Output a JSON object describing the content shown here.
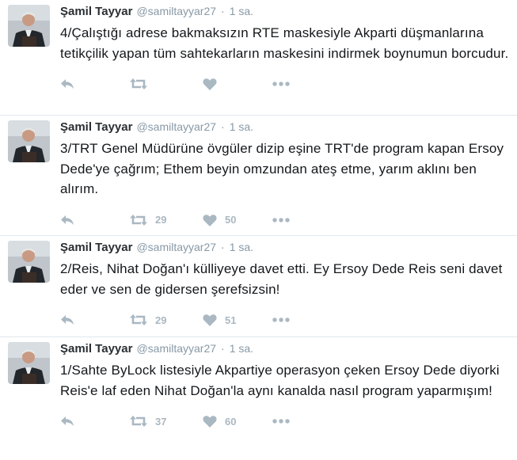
{
  "tweets": [
    {
      "fullname": "Şamil Tayyar",
      "username": "@samiltayyar27",
      "separator": "·",
      "time": "1 sa.",
      "text": "4/Çalıştığı adrese bakmaksızın RTE maskesiyle Akparti düşmanlarına tetikçilik yapan tüm sahtekarların maskesini indirmek boynumun borcudur.",
      "retweets": "",
      "likes": ""
    },
    {
      "fullname": "Şamil Tayyar",
      "username": "@samiltayyar27",
      "separator": "·",
      "time": "1 sa.",
      "text": "3/TRT Genel Müdürüne övgüler dizip eşine TRT'de program kapan Ersoy Dede'ye çağrım; Ethem beyin omzundan ateş etme, yarım aklını ben alırım.",
      "retweets": "29",
      "likes": "50"
    },
    {
      "fullname": "Şamil Tayyar",
      "username": "@samiltayyar27",
      "separator": "·",
      "time": "1 sa.",
      "text": "2/Reis, Nihat Doğan'ı külliyeye davet etti. Ey Ersoy Dede Reis seni davet eder ve sen de gidersen şerefsizsin!",
      "retweets": "29",
      "likes": "51"
    },
    {
      "fullname": "Şamil Tayyar",
      "username": "@samiltayyar27",
      "separator": "·",
      "time": "1 sa.",
      "text": "1/Sahte ByLock listesiyle Akpartiye operasyon çeken Ersoy Dede diyorki Reis'e laf eden Nihat Doğan'la aynı kanalda nasıl program yaparmışım!",
      "retweets": "37",
      "likes": "60"
    }
  ],
  "icons": {
    "reply": "reply-icon",
    "retweet": "retweet-icon",
    "like": "heart-icon",
    "more": "more-dots-icon"
  },
  "colors": {
    "name": "#292f33",
    "muted": "#8899a6",
    "action": "#aab8c2",
    "text": "#14171a",
    "border": "#e1e8ed"
  }
}
